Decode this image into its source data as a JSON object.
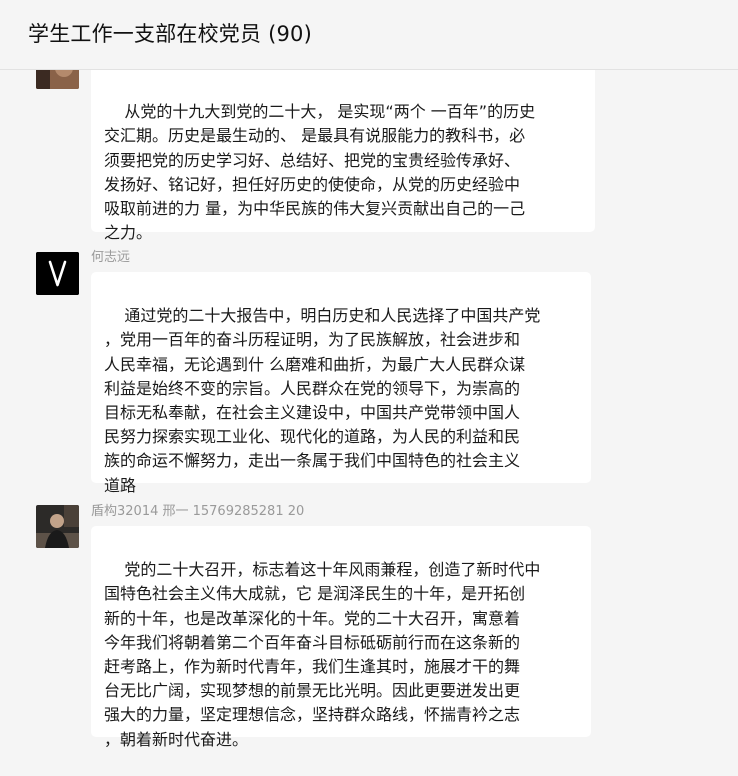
{
  "chat": {
    "title": "学生工作一支部在校党员 (90)"
  },
  "messages": [
    {
      "sender": "",
      "avatar_icon": "photo-avatar-icon",
      "text": "从党的十九大到党的二十大， 是实现“两个 一百年”的历史\n交汇期。历史是最生动的、 是最具有说服能力的教科书，必\n须要把党的历史学习好、总结好、把党的宝贵经验传承好、\n发扬好、铭记好，担任好历史的使使命，从党的历史经验中\n吸取前进的力 量，为中华民族的伟大复兴贡献出自己的一己\n之力。"
    },
    {
      "sender": "何志远",
      "avatar_icon": "v-letter-avatar-icon",
      "avatar_letter": "V",
      "text": "通过党的二十大报告中，明白历史和人民选择了中国共产党\n，党用一百年的奋斗历程证明，为了民族解放，社会进步和\n人民幸福，无论遇到什 么磨难和曲折，为最广大人民群众谋\n利益是始终不变的宗旨。人民群众在党的领导下，为崇高的\n目标无私奉献，在社会主义建设中，中国共产党带领中国人\n民努力探索实现工业化、现代化的道路，为人民的利益和民\n族的命运不懈努力，走出一条属于我们中国特色的社会主义\n道路"
    },
    {
      "sender": "盾构32014  邢一  15769285281  20",
      "avatar_icon": "person-photo-avatar-icon",
      "text": "党的二十大召开，标志着这十年风雨兼程，创造了新时代中\n国特色社会主义伟大成就，它 是润泽民生的十年，是开拓创\n新的十年，也是改革深化的十年。党的二十大召开，寓意着\n今年我们将朝着第二个百年奋斗目标砥砺前行而在这条新的\n赶考路上，作为新时代青年，我们生逢其时，施展才干的舞\n台无比广阔，实现梦想的前景无比光明。因此更要迸发出更\n强大的力量，坚定理想信念，坚持群众路线，怀揣青衿之志\n，朝着新时代奋进。"
    }
  ]
}
